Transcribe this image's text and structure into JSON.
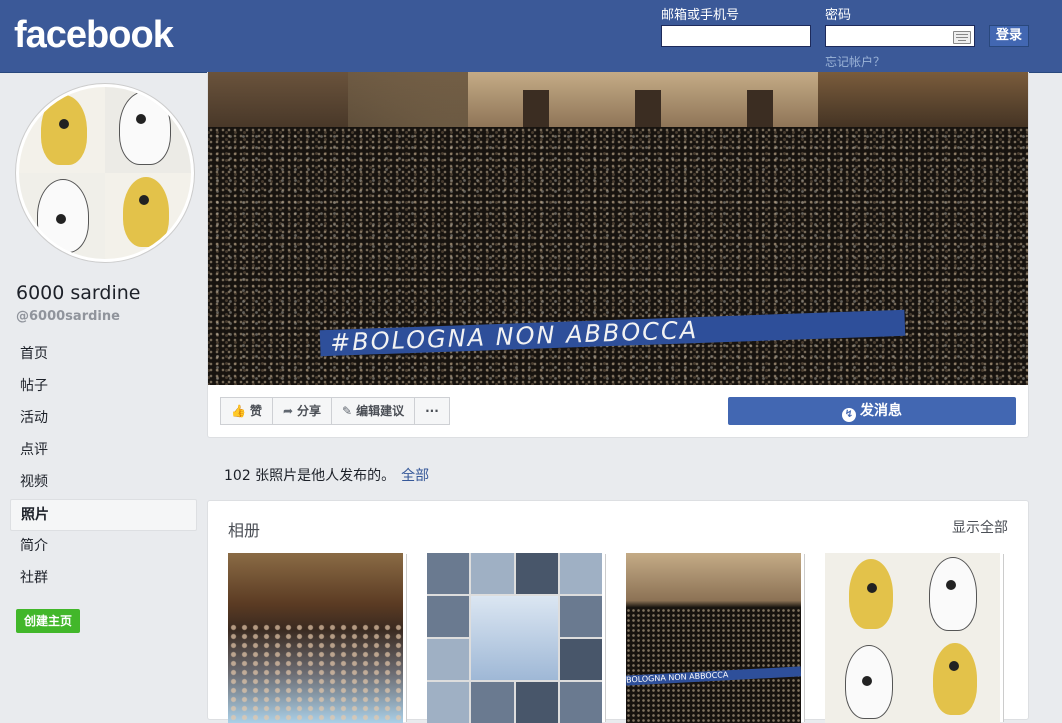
{
  "header": {
    "logo": "facebook",
    "email_label": "邮箱或手机号",
    "email_value": "",
    "password_label": "密码",
    "password_value": "",
    "login_button": "登录",
    "forgot_link": "忘记帐户？"
  },
  "profile": {
    "name": "6000 sardine",
    "handle": "@6000sardine"
  },
  "sidebar": {
    "items": [
      {
        "label": "首页"
      },
      {
        "label": "帖子"
      },
      {
        "label": "活动"
      },
      {
        "label": "点评"
      },
      {
        "label": "视频"
      },
      {
        "label": "照片",
        "active": true
      },
      {
        "label": "简介"
      },
      {
        "label": "社群"
      }
    ],
    "create_page": "创建主页"
  },
  "cover": {
    "banner_text": "#BOLOGNA NON ABBOCCA"
  },
  "actions": {
    "like": "赞",
    "share": "分享",
    "suggest_edits": "编辑建议",
    "more": "···",
    "send_message": "发消息"
  },
  "photos": {
    "note": "102 张照片是他人发布的。",
    "all_link": "全部"
  },
  "albums": {
    "title": "相册",
    "show_all": "显示全部",
    "mini_banner": "BOLOGNA NON ABBOCCA"
  },
  "colors": {
    "brand_blue": "#3b5998",
    "button_blue": "#4267b2",
    "green": "#42b72a",
    "link": "#365899"
  }
}
